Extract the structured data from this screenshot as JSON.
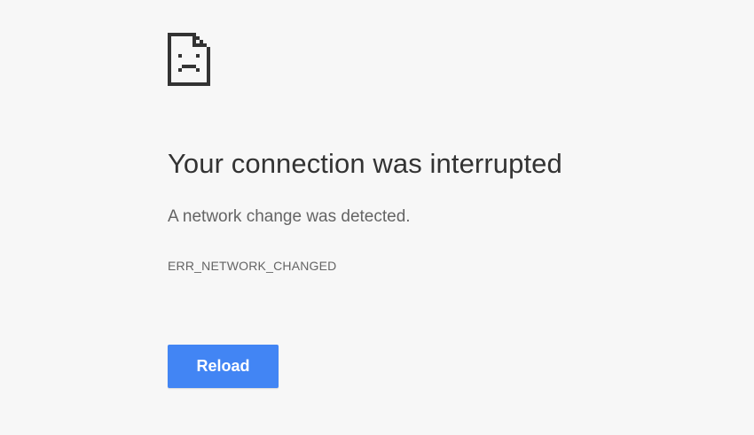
{
  "error_page": {
    "icon": "sad-document-icon",
    "title": "Your connection was interrupted",
    "subtitle": "A network change was detected.",
    "error_code": "ERR_NETWORK_CHANGED",
    "reload_label": "Reload"
  },
  "colors": {
    "background": "#f7f7f7",
    "title_text": "#333333",
    "body_text": "#646464",
    "button_bg": "#4285f4",
    "button_text": "#ffffff",
    "icon": "#333333"
  }
}
